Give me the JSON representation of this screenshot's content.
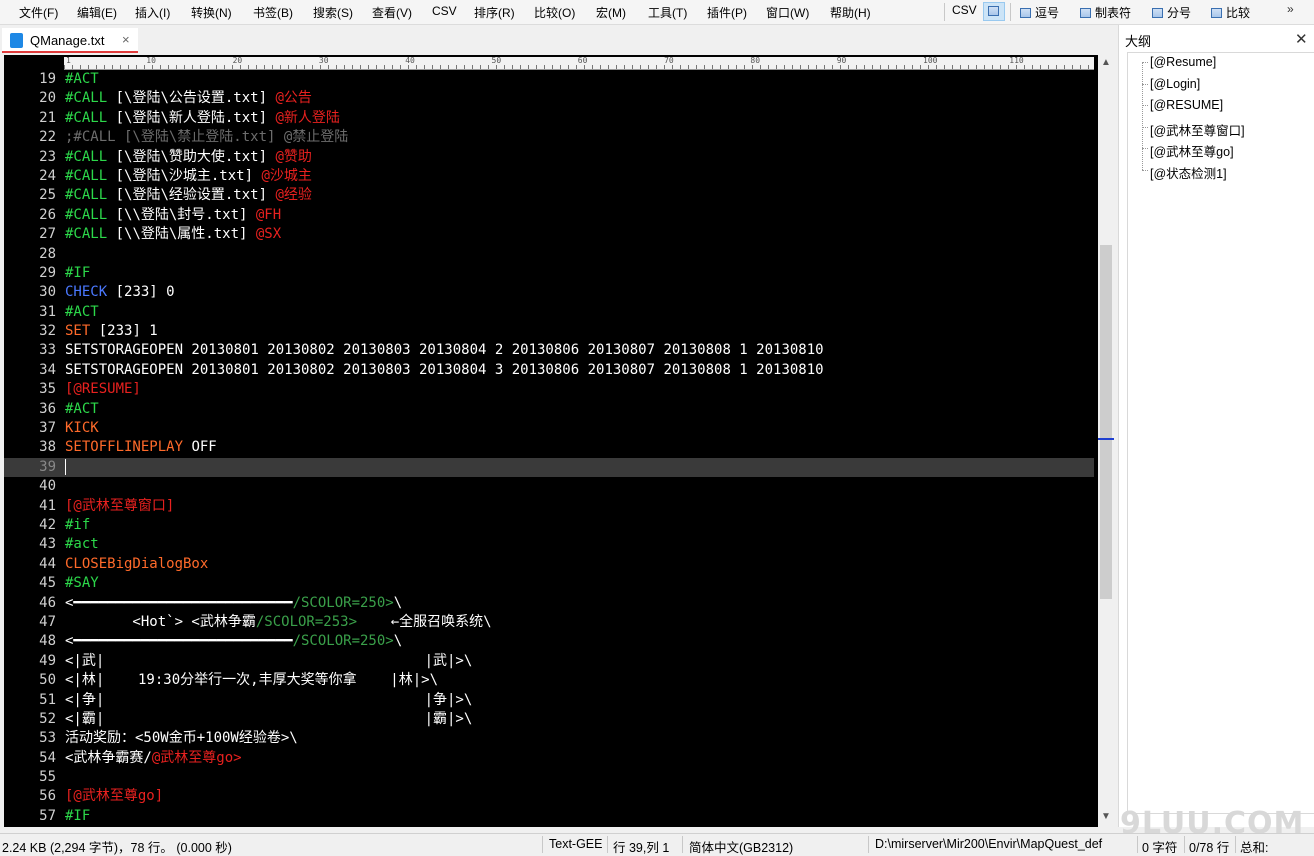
{
  "menu": [
    "文件(F)",
    "编辑(E)",
    "插入(I)",
    "转换(N)",
    "书签(B)",
    "搜索(S)",
    "查看(V)",
    "CSV",
    "排序(R)",
    "比较(O)",
    "宏(M)",
    "工具(T)",
    "插件(P)",
    "窗口(W)",
    "帮助(H)"
  ],
  "toolbar": {
    "csv": "CSV",
    "comma": "逗号",
    "tab": "制表符",
    "semicolon": "分号",
    "compare": "比较",
    "more": "»"
  },
  "tab": {
    "label": "QManage.txt",
    "close": "×"
  },
  "outline": {
    "title": "大纲",
    "close": "✕",
    "items": [
      "[@Resume]",
      "[@Login]",
      "[@RESUME]",
      "[@武林至尊窗口]",
      "[@武林至尊go]",
      "[@状态检测1]"
    ]
  },
  "ruler_numbers": [
    "1",
    "10",
    "20",
    "30",
    "40",
    "50",
    "60",
    "70",
    "80",
    "90",
    "100",
    "110"
  ],
  "editor_lines": [
    {
      "n": "19",
      "seg": [
        {
          "t": "#ACT",
          "c": "green"
        }
      ]
    },
    {
      "n": "20",
      "seg": [
        {
          "t": "#CALL",
          "c": "green"
        },
        {
          "t": " [\\登陆\\公告设置.txt] ",
          "c": "white"
        },
        {
          "t": "@公告",
          "c": "red"
        }
      ]
    },
    {
      "n": "21",
      "seg": [
        {
          "t": "#CALL",
          "c": "green"
        },
        {
          "t": " [\\登陆\\新人登陆.txt] ",
          "c": "white"
        },
        {
          "t": "@新人登陆",
          "c": "red"
        }
      ]
    },
    {
      "n": "22",
      "seg": [
        {
          "t": ";#CALL [\\登陆\\禁止登陆.txt] @禁止登陆",
          "c": "grey"
        }
      ]
    },
    {
      "n": "23",
      "seg": [
        {
          "t": "#CALL",
          "c": "green"
        },
        {
          "t": " [\\登陆\\赞助大使.txt] ",
          "c": "white"
        },
        {
          "t": "@赞助",
          "c": "red"
        }
      ]
    },
    {
      "n": "24",
      "seg": [
        {
          "t": "#CALL",
          "c": "green"
        },
        {
          "t": " [\\登陆\\沙城主.txt] ",
          "c": "white"
        },
        {
          "t": "@沙城主",
          "c": "red"
        }
      ]
    },
    {
      "n": "25",
      "seg": [
        {
          "t": "#CALL",
          "c": "green"
        },
        {
          "t": " [\\登陆\\经验设置.txt] ",
          "c": "white"
        },
        {
          "t": "@经验",
          "c": "red"
        }
      ]
    },
    {
      "n": "26",
      "seg": [
        {
          "t": "#CALL",
          "c": "green"
        },
        {
          "t": " [\\\\登陆\\封号.txt] ",
          "c": "white"
        },
        {
          "t": "@FH",
          "c": "red"
        }
      ]
    },
    {
      "n": "27",
      "seg": [
        {
          "t": "#CALL",
          "c": "green"
        },
        {
          "t": " [\\\\登陆\\属性.txt] ",
          "c": "white"
        },
        {
          "t": "@SX",
          "c": "red"
        }
      ]
    },
    {
      "n": "28",
      "seg": []
    },
    {
      "n": "29",
      "seg": [
        {
          "t": "#IF",
          "c": "green"
        }
      ]
    },
    {
      "n": "30",
      "seg": [
        {
          "t": "CHECK",
          "c": "blue"
        },
        {
          "t": " [233] 0",
          "c": "white"
        }
      ]
    },
    {
      "n": "31",
      "seg": [
        {
          "t": "#ACT",
          "c": "green"
        }
      ]
    },
    {
      "n": "32",
      "seg": [
        {
          "t": "SET",
          "c": "orange"
        },
        {
          "t": " [233] 1",
          "c": "white"
        }
      ]
    },
    {
      "n": "33",
      "seg": [
        {
          "t": "SETSTORAGEOPEN 20130801 20130802 20130803 20130804 2 20130806 20130807 20130808 1 20130810",
          "c": "white"
        }
      ]
    },
    {
      "n": "34",
      "seg": [
        {
          "t": "SETSTORAGEOPEN 20130801 20130802 20130803 20130804 3 20130806 20130807 20130808 1 20130810",
          "c": "white"
        }
      ]
    },
    {
      "n": "35",
      "seg": [
        {
          "t": "[@RESUME]",
          "c": "red"
        }
      ]
    },
    {
      "n": "36",
      "seg": [
        {
          "t": "#ACT",
          "c": "green"
        }
      ]
    },
    {
      "n": "37",
      "seg": [
        {
          "t": "KICK",
          "c": "orange"
        }
      ]
    },
    {
      "n": "38",
      "seg": [
        {
          "t": "SETOFFLINEPLAY",
          "c": "orange"
        },
        {
          "t": " OFF",
          "c": "white"
        }
      ]
    },
    {
      "n": "39",
      "seg": [],
      "current": true
    },
    {
      "n": "40",
      "seg": []
    },
    {
      "n": "41",
      "seg": [
        {
          "t": "[@武林至尊窗口]",
          "c": "red"
        }
      ]
    },
    {
      "n": "42",
      "seg": [
        {
          "t": "#if",
          "c": "green"
        }
      ]
    },
    {
      "n": "43",
      "seg": [
        {
          "t": "#act",
          "c": "green"
        }
      ]
    },
    {
      "n": "44",
      "seg": [
        {
          "t": "CLOSEBigDialogBox",
          "c": "orange"
        }
      ]
    },
    {
      "n": "45",
      "seg": [
        {
          "t": "#SAY",
          "c": "green"
        }
      ]
    },
    {
      "n": "46",
      "seg": [
        {
          "t": "<━━━━━━━━━━━━━━━━━━━━━━━━━━",
          "c": "white"
        },
        {
          "t": "/SCOLOR=250>",
          "c": "lgreen"
        },
        {
          "t": "\\",
          "c": "white"
        }
      ]
    },
    {
      "n": "47",
      "seg": [
        {
          "t": "        <Hot`> <武林争霸",
          "c": "white"
        },
        {
          "t": "/SCOLOR=253>",
          "c": "lgreen"
        },
        {
          "t": "    ←全服召唤系统\\",
          "c": "white"
        }
      ]
    },
    {
      "n": "48",
      "seg": [
        {
          "t": "<━━━━━━━━━━━━━━━━━━━━━━━━━━",
          "c": "white"
        },
        {
          "t": "/SCOLOR=250>",
          "c": "lgreen"
        },
        {
          "t": "\\",
          "c": "white"
        }
      ]
    },
    {
      "n": "49",
      "seg": [
        {
          "t": "<|武|                                      |武|>\\",
          "c": "white"
        }
      ]
    },
    {
      "n": "50",
      "seg": [
        {
          "t": "<|林|    19:30分举行一次,丰厚大奖等你拿    |林|>\\",
          "c": "white"
        }
      ]
    },
    {
      "n": "51",
      "seg": [
        {
          "t": "<|争|                                      |争|>\\",
          "c": "white"
        }
      ]
    },
    {
      "n": "52",
      "seg": [
        {
          "t": "<|霸|                                      |霸|>\\",
          "c": "white"
        }
      ]
    },
    {
      "n": "53",
      "seg": [
        {
          "t": "活动奖励：<50W金币+100W经验卷>\\",
          "c": "white"
        }
      ]
    },
    {
      "n": "54",
      "seg": [
        {
          "t": "<武林争霸赛/",
          "c": "white"
        },
        {
          "t": "@武林至尊go>",
          "c": "red"
        }
      ]
    },
    {
      "n": "55",
      "seg": []
    },
    {
      "n": "56",
      "seg": [
        {
          "t": "[@武林至尊go]",
          "c": "red"
        }
      ]
    },
    {
      "n": "57",
      "seg": [
        {
          "t": "#IF",
          "c": "green"
        }
      ]
    }
  ],
  "status": {
    "size": "2.24 KB (2,294 字节)，78 行。 (0.000 秒)",
    "syntax": "Text-GEE",
    "position": "行 39,列 1",
    "encoding": "简体中文(GB2312)",
    "path": "D:\\mirserver\\Mir200\\Envir\\MapQuest_def",
    "chars": "0 字符",
    "lines": "0/78 行",
    "sum": "总和:"
  },
  "watermark": "9LUU.COM",
  "colors": {
    "green": "#2cd84a",
    "white": "#ffffff",
    "red": "#e8211f",
    "blue": "#4a78ff",
    "orange": "#ff6a2a",
    "grey": "#6d6d6d",
    "lgreen": "#3aa04a",
    "tab_underline": "#e03c3c"
  }
}
